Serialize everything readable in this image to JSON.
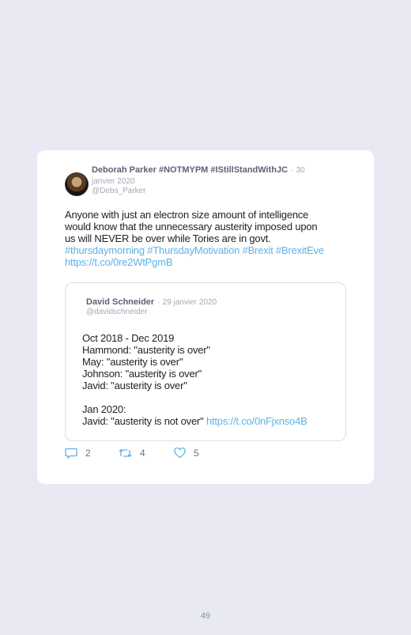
{
  "tweet": {
    "author": "Deborah Parker #NOTMYPM #IStillStandWithJC",
    "date_line1": "30",
    "date_line2": "janvier 2020",
    "handle": "@Debs_Parker",
    "body_lines": [
      "Anyone with just an electron size amount of intelligence",
      "would know that the unnecessary austerity imposed upon",
      "us will NEVER be over while Tories are in govt."
    ],
    "hashtags": "#thursdaymorning #ThursdayMotivation #Brexit #BrexitEve",
    "link": "https://t.co/0re2WtPgmB",
    "replies": "2",
    "retweets": "4",
    "likes": "5"
  },
  "quoted": {
    "author": "David Schneider",
    "date": "29 janvier 2020",
    "handle": "@davidschneider",
    "lines": [
      "Oct 2018 - Dec 2019",
      "Hammond: \"austerity is over\"",
      "May: \"austerity is over\"",
      "Johnson: \"austerity is over\"",
      "Javid: \"austerity is over\"",
      "",
      "Jan 2020:",
      "Javid: \"austerity is not over\""
    ],
    "link": "https://t.co/0nFjxnso4B"
  },
  "page_number": "49",
  "colors": {
    "link": "#5fb1e6",
    "background": "#e8e9f3"
  },
  "icons": {
    "reply": "reply-icon",
    "retweet": "retweet-icon",
    "like": "heart-icon"
  }
}
